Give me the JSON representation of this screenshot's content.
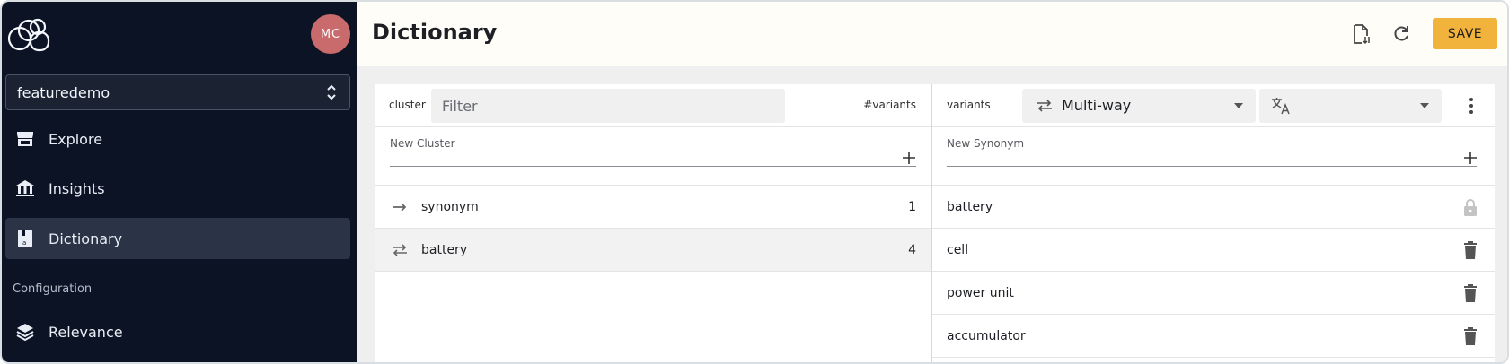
{
  "sidebar": {
    "logo_icon": "logo-icon",
    "avatar_initials": "MC",
    "project": {
      "selected": "featuredemo"
    },
    "nav": [
      {
        "label": "Explore",
        "icon": "store-icon"
      },
      {
        "label": "Insights",
        "icon": "bank-icon"
      },
      {
        "label": "Dictionary",
        "icon": "dictionary-icon",
        "active": true
      }
    ],
    "section_label": "Configuration",
    "config_nav": [
      {
        "label": "Relevance",
        "icon": "layers-icon"
      }
    ]
  },
  "header": {
    "title": "Dictionary",
    "save_label": "SAVE",
    "icons": [
      "file-import-icon",
      "refresh-icon"
    ]
  },
  "clusters": {
    "cluster_label": "cluster",
    "filter_placeholder": "Filter",
    "variants_count_label": "#variants",
    "new_cluster_label": "New Cluster",
    "rows": [
      {
        "icon": "arrow-right-icon",
        "name": "synonym",
        "count": "1"
      },
      {
        "icon": "swap-horizontal-icon",
        "name": "battery",
        "count": "4",
        "selected": true
      }
    ]
  },
  "variants": {
    "variants_label": "variants",
    "type_value": "Multi-way",
    "language_value": "",
    "new_synonym_label": "New Synonym",
    "rows": [
      {
        "text": "battery",
        "action": "lock-icon"
      },
      {
        "text": "cell",
        "action": "delete-icon"
      },
      {
        "text": "power unit",
        "action": "delete-icon"
      },
      {
        "text": "accumulator",
        "action": "delete-icon"
      }
    ]
  },
  "colors": {
    "sidebar_bg": "#0b1324",
    "active_nav_bg": "#2a3446",
    "save_accent": "#f2b33d",
    "avatar_bg": "#c96a6d"
  }
}
